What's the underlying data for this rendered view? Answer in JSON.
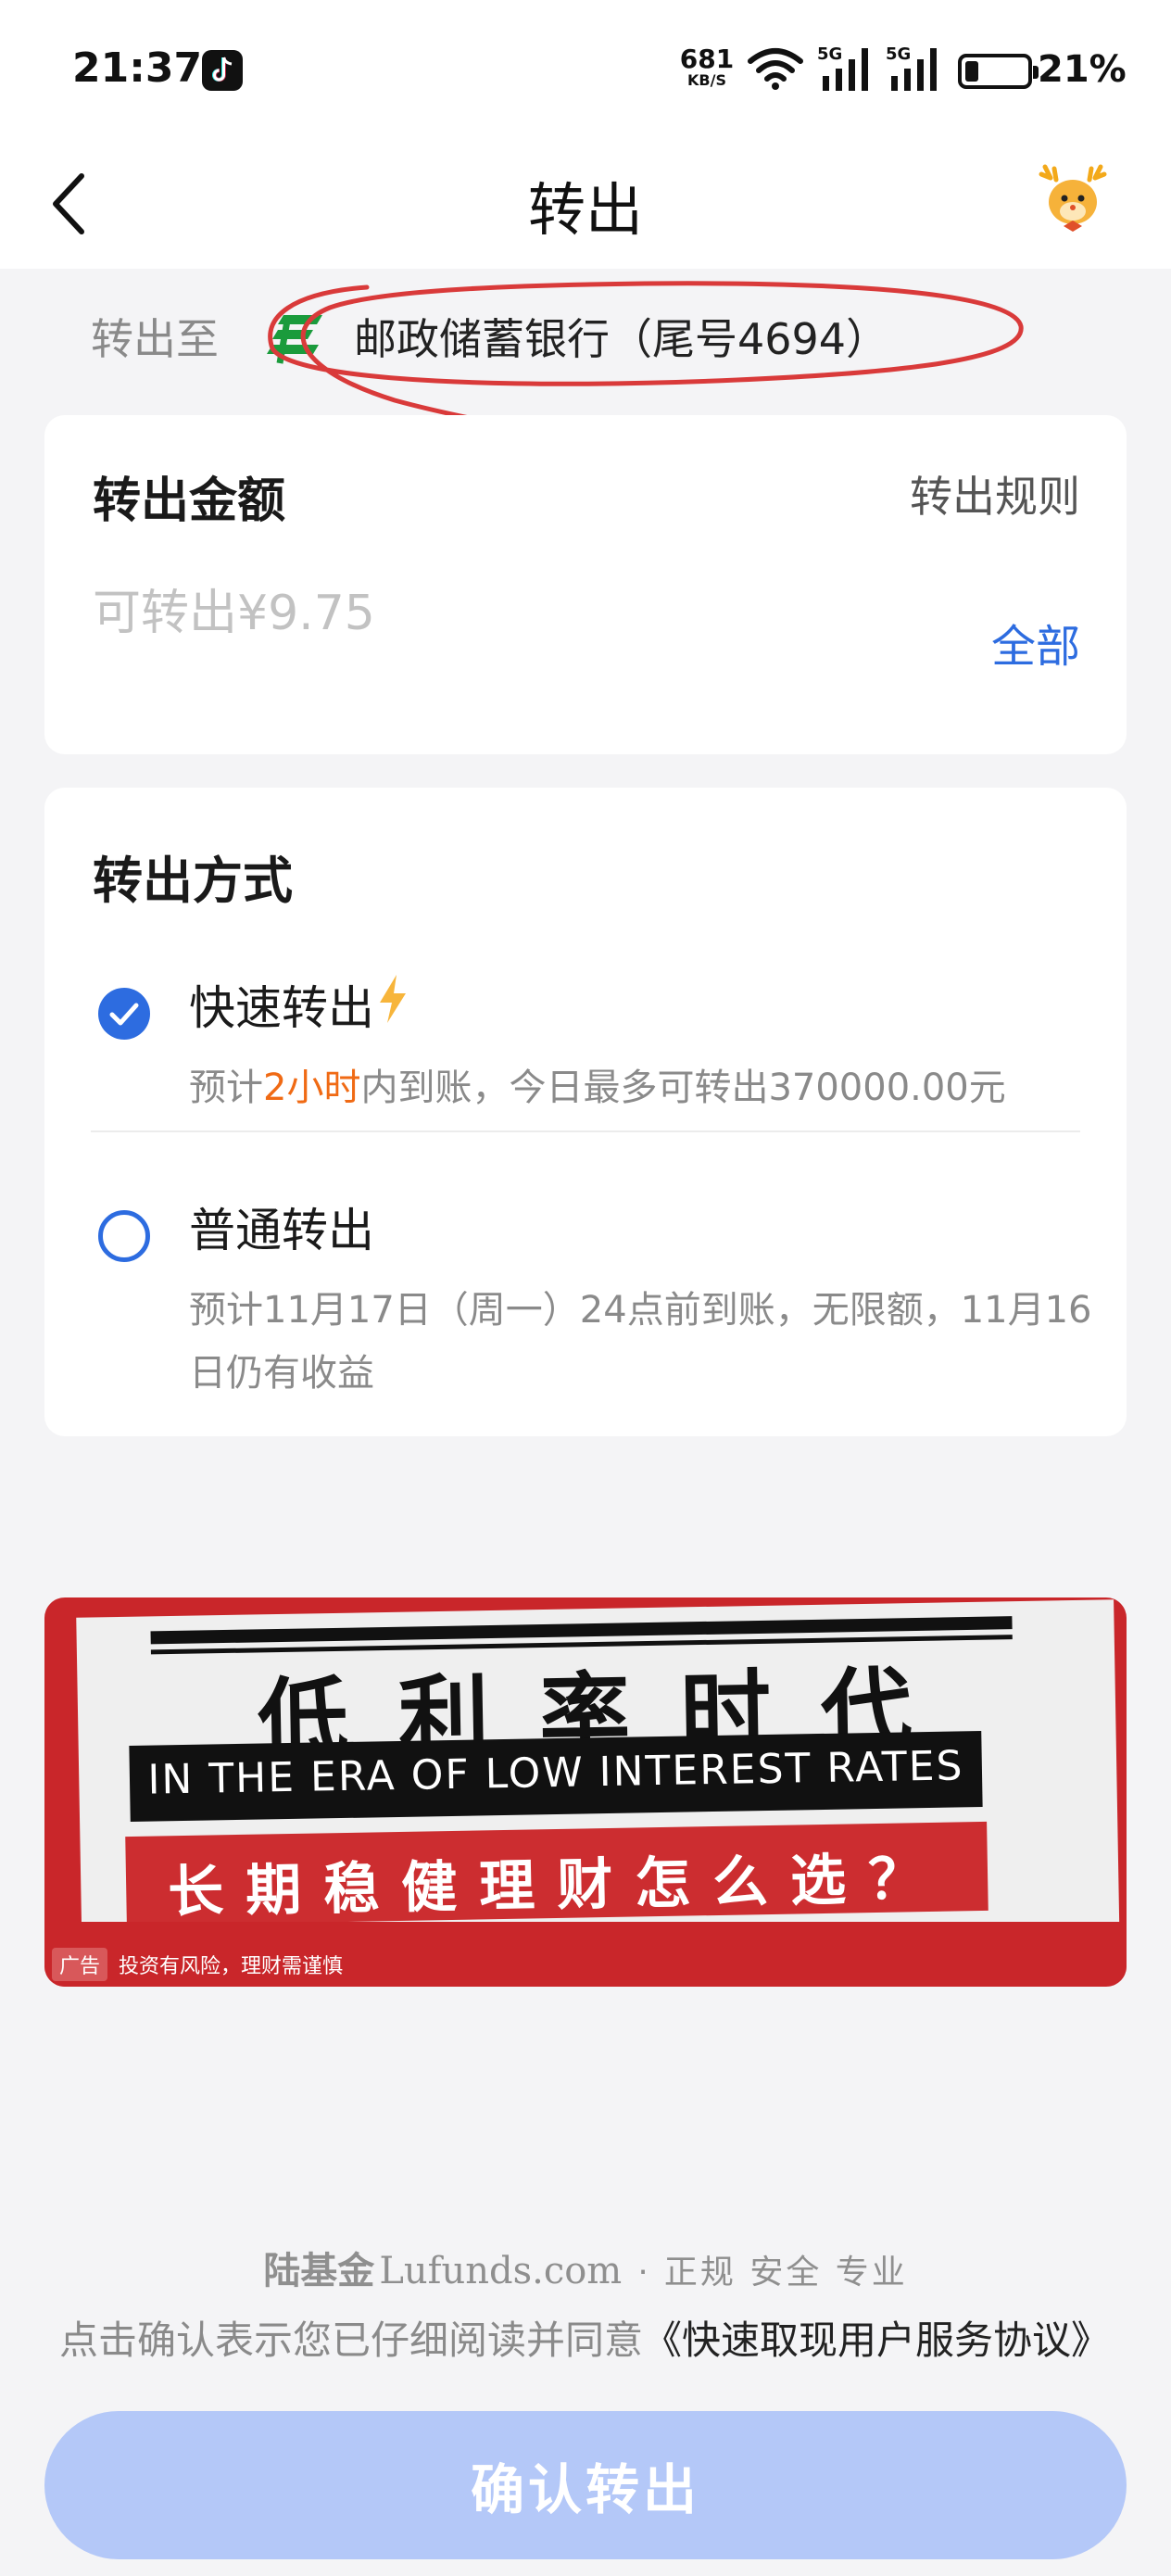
{
  "status_bar": {
    "time": "21:37",
    "net_speed": "681",
    "net_unit": "KB/S",
    "battery": "21%",
    "signal_labels": [
      "5G",
      "5G"
    ]
  },
  "header": {
    "title": "转出"
  },
  "destination": {
    "label": "转出至",
    "bank": "邮政储蓄银行（尾号4694）"
  },
  "amount_card": {
    "title": "转出金额",
    "rules_link": "转出规则",
    "placeholder": "可转出¥9.75",
    "all_button": "全部"
  },
  "method_card": {
    "title": "转出方式",
    "options": [
      {
        "label": "快速转出",
        "desc_prefix": "预计",
        "desc_highlight": "2小时",
        "desc_suffix": "内到账，今日最多可转出370000.00元",
        "selected": true
      },
      {
        "label": "普通转出",
        "desc": "预计11月17日（周一）24点前到账，无限额，11月16日仍有收益",
        "selected": false
      }
    ]
  },
  "ad": {
    "headline_zh": "低利率时代",
    "headline_en": "IN THE ERA OF LOW INTEREST RATES",
    "subline": "长期稳健理财怎么选？",
    "tag": "广告",
    "disclaimer": "投资有风险，理财需谨慎"
  },
  "footer": {
    "brand": "陆基金",
    "domain": "Lufunds.com",
    "tagline": "正规 安全 专业",
    "agree_text": "点击确认表示您已仔细阅读并同意",
    "agree_link": "《快速取现用户服务协议》",
    "confirm_button": "确认转出"
  },
  "colors": {
    "accent": "#2d6ce0",
    "highlight": "#f06a14",
    "button_disabled": "#b4c8f8",
    "annotation_red": "#d93a3a",
    "bank_green": "#1a9b3c"
  }
}
